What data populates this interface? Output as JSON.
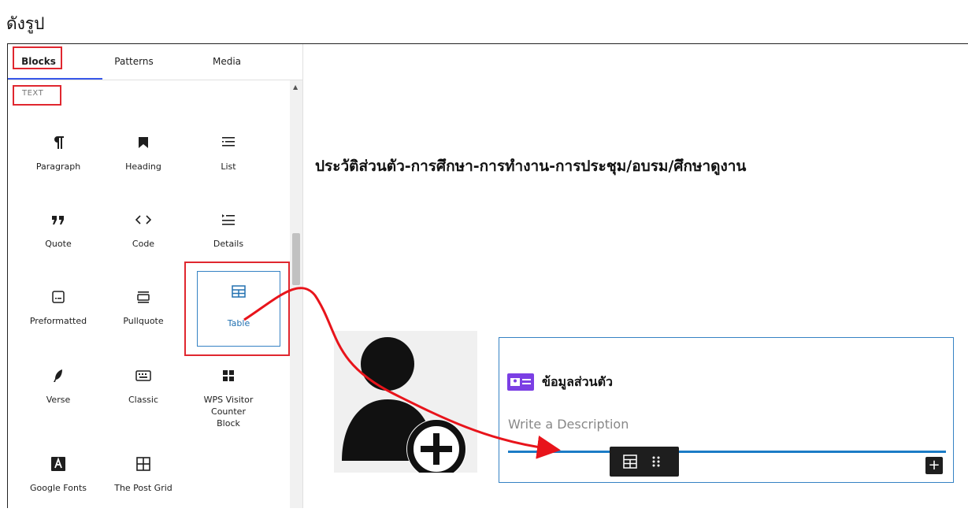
{
  "caption": "ดังรูป",
  "inserter": {
    "tabs": [
      "Blocks",
      "Patterns",
      "Media"
    ],
    "section_label": "TEXT",
    "blocks": [
      {
        "label": "Paragraph",
        "icon": "paragraph-icon"
      },
      {
        "label": "Heading",
        "icon": "bookmark-icon"
      },
      {
        "label": "List",
        "icon": "list-icon"
      },
      {
        "label": "Quote",
        "icon": "quote-icon"
      },
      {
        "label": "Code",
        "icon": "code-icon"
      },
      {
        "label": "Details",
        "icon": "details-icon"
      },
      {
        "label": "Preformatted",
        "icon": "preformatted-icon"
      },
      {
        "label": "Pullquote",
        "icon": "pullquote-icon"
      },
      {
        "label": "Table",
        "icon": "table-icon"
      },
      {
        "label": "Verse",
        "icon": "quill-icon"
      },
      {
        "label": "Classic",
        "icon": "keyboard-icon"
      },
      {
        "label": "WPS Visitor Counter Block",
        "icon": "grid-squares-icon"
      },
      {
        "label": "Google Fonts",
        "icon": "letter-a-icon"
      },
      {
        "label": "The Post Grid",
        "icon": "post-grid-icon"
      }
    ],
    "selected_block": "Table"
  },
  "canvas": {
    "heading": "ประวัติส่วนตัว-การศึกษา-การทำงาน-การประชุม/อบรม/ศึกษาดูงาน",
    "card_title": "ข้อมูลส่วนตัว",
    "card_description": "Write a Description",
    "add_button": "+"
  },
  "colors": {
    "highlight_box": "#e0272f",
    "accent_blue": "#3582c4",
    "arrow": "#e8141b"
  }
}
